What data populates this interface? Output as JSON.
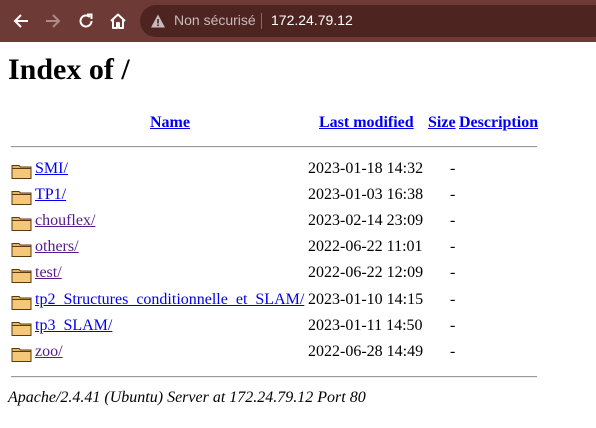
{
  "browser": {
    "security_label": "Non sécurisé",
    "url": "172.24.79.12",
    "colors": {
      "toolbar": "#6e3a36",
      "omnibox": "#4e2421"
    }
  },
  "page": {
    "title": "Index of /",
    "columns": {
      "name": "Name",
      "last_modified": "Last modified",
      "size": "Size",
      "description": "Description"
    },
    "entries": [
      {
        "name": "SMI/",
        "modified": "2023-01-18 14:32",
        "size": "-",
        "visited": false
      },
      {
        "name": "TP1/",
        "modified": "2023-01-03 16:38",
        "size": "-",
        "visited": false
      },
      {
        "name": "chouflex/",
        "modified": "2023-02-14 23:09",
        "size": "-",
        "visited": true
      },
      {
        "name": "others/",
        "modified": "2022-06-22 11:01",
        "size": "-",
        "visited": true
      },
      {
        "name": "test/",
        "modified": "2022-06-22 12:09",
        "size": "-",
        "visited": true
      },
      {
        "name": "tp2_Structures_conditionnelle_et_SLAM/",
        "modified": "2023-01-10 14:15",
        "size": "-",
        "visited": false
      },
      {
        "name": "tp3_SLAM/",
        "modified": "2023-01-11 14:50",
        "size": "-",
        "visited": false
      },
      {
        "name": "zoo/",
        "modified": "2022-06-28 14:49",
        "size": "-",
        "visited": true
      }
    ],
    "footer": "Apache/2.4.41 (Ubuntu) Server at 172.24.79.12 Port 80"
  }
}
